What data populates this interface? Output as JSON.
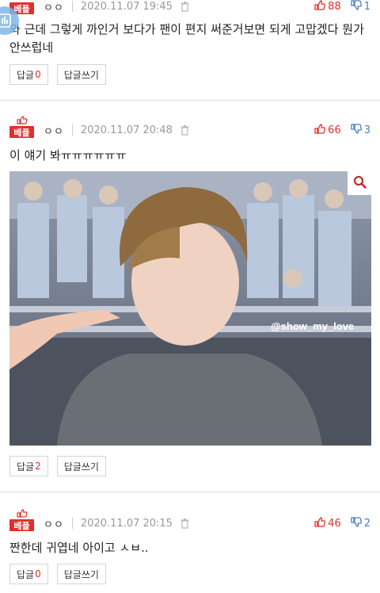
{
  "comments": [
    {
      "badge": "베플",
      "nick": "ㅇㅇ",
      "date": "2020.11.07 19:45",
      "likes": "88",
      "dislikes": "1",
      "text": "와 근데 그렇게 까인거 보다가 팬이 편지 써준거보면 되게 고맙겠다 뭔가 안쓰럽네",
      "reply_label": "답글",
      "reply_count": "0",
      "write_label": "답글쓰기"
    },
    {
      "badge": "베플",
      "nick": "ㅇㅇ",
      "date": "2020.11.07 20:48",
      "likes": "66",
      "dislikes": "3",
      "text": "이 얘기 봐ㅠㅠㅠㅠㅠㅠ",
      "image_caption": "@show_my_love",
      "reply_label": "답글",
      "reply_count": "2",
      "write_label": "답글쓰기"
    },
    {
      "badge": "베플",
      "nick": "ㅇㅇ",
      "date": "2020.11.07 20:15",
      "likes": "46",
      "dislikes": "2",
      "text": "짠한데 귀엽네 아이고 ㅅㅂ..",
      "reply_label": "답글",
      "reply_count": "0",
      "write_label": "답글쓰기"
    }
  ],
  "colors": {
    "accent": "#e0302b",
    "down": "#4a7fbf"
  },
  "icons": [
    "thumbs-up-icon",
    "thumbs-down-icon",
    "trash-icon",
    "search-icon",
    "floating-app-icon"
  ]
}
